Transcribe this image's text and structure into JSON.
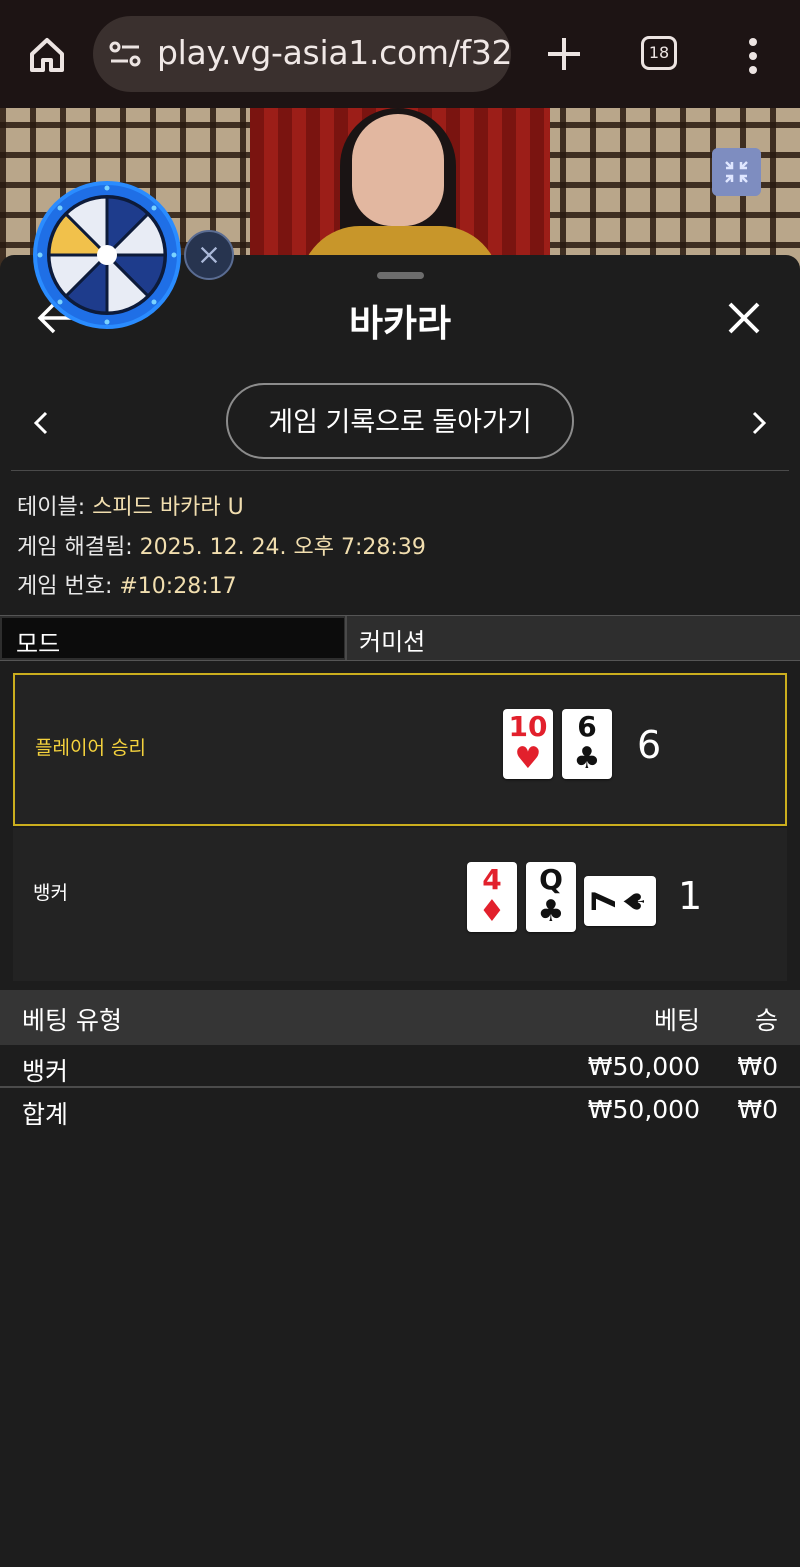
{
  "browser": {
    "url": "play.vg-asia1.com/f32",
    "tab_count": "18"
  },
  "panel": {
    "title": "바카라",
    "history_button": "게임 기록으로 돌아가기"
  },
  "info": {
    "table_label": "테이블: ",
    "table_value": "스피드 바카라 U",
    "resolved_label": "게임 해결됨: ",
    "resolved_value": "2025. 12. 24. 오후 7:28:39",
    "game_no_label": "게임 번호: ",
    "game_no_value": "#10:28:17"
  },
  "mode": {
    "label": "모드",
    "value": "커미션"
  },
  "results": {
    "player": {
      "label": "플레이어 승리",
      "score": "6",
      "cards": [
        {
          "rank": "10",
          "suit": "♥",
          "color": "#e2202c"
        },
        {
          "rank": "6",
          "suit": "♣",
          "color": "#111111"
        }
      ]
    },
    "banker": {
      "label": "뱅커",
      "score": "1",
      "cards": [
        {
          "rank": "4",
          "suit": "♦",
          "color": "#e2202c"
        },
        {
          "rank": "Q",
          "suit": "♣",
          "color": "#111111"
        },
        {
          "rank": "7",
          "suit": "♠",
          "color": "#111111"
        }
      ]
    }
  },
  "bets": {
    "headers": {
      "type": "베팅 유형",
      "bet": "베팅",
      "win": "승"
    },
    "rows": [
      {
        "type": "뱅커",
        "bet": "₩50,000",
        "win": "₩0"
      },
      {
        "type": "합계",
        "bet": "₩50,000",
        "win": "₩0"
      }
    ]
  },
  "colors": {
    "win_highlight": "#cbae1e",
    "win_text": "#f4d23d",
    "info_value": "#f1deaf"
  }
}
